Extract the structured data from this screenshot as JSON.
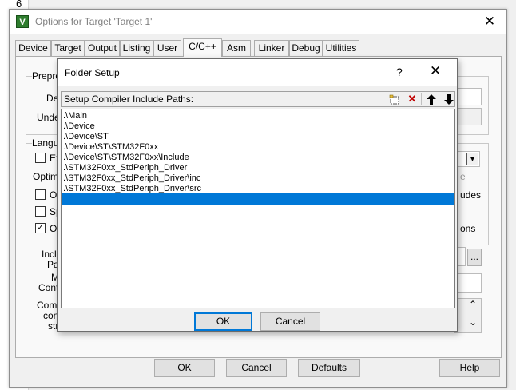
{
  "editor": {
    "line_number": "6"
  },
  "window": {
    "title": "Options for Target 'Target 1'",
    "close_glyph": "✕",
    "icon_letter": "V"
  },
  "tabs": [
    {
      "label": "Device"
    },
    {
      "label": "Target"
    },
    {
      "label": "Output"
    },
    {
      "label": "Listing"
    },
    {
      "label": "User"
    },
    {
      "label": "C/C++",
      "active": true
    },
    {
      "label": "Asm"
    },
    {
      "label": "Linker"
    },
    {
      "label": "Debug"
    },
    {
      "label": "Utilities"
    }
  ],
  "background_panel": {
    "preprocessor_label": "Prepro",
    "define_label": "De",
    "undefine_label": "Unde",
    "language_label": "Langu",
    "execute_only_label": "Ex",
    "optimization_label": "Optimiz",
    "option1_label": "Op",
    "option2_label": "Sp",
    "option3_label": "On",
    "option3_checked": "✓",
    "include_label": "Inclu",
    "paths_label": "Pat",
    "misc_label": "M",
    "controls_label": "Contr",
    "compiler_label": "Comp",
    "control_label": "cont",
    "string_label": "stri",
    "right_text_e": "e",
    "right_text_udes": "udes",
    "right_text_ons": "ons",
    "browse_button": "...",
    "dropdown_glyph": "▾",
    "scroll_up_glyph": "⌃",
    "scroll_down_glyph": "⌄"
  },
  "footer_buttons": {
    "ok": "OK",
    "cancel": "Cancel",
    "defaults": "Defaults",
    "help": "Help"
  },
  "folder_setup": {
    "title": "Folder Setup",
    "help_glyph": "?",
    "close_glyph": "✕",
    "list_header": "Setup Compiler Include Paths:",
    "toolbar": {
      "new_icon": "new-folder-icon",
      "delete_icon": "delete-icon",
      "up_icon": "move-up-icon",
      "down_icon": "move-down-icon",
      "delete_glyph": "✕",
      "up_glyph": "🡅",
      "down_glyph": "🡇",
      "delete_color": "#c00000"
    },
    "paths": [
      ".\\Main",
      ".\\Device",
      ".\\Device\\ST",
      ".\\Device\\ST\\STM32F0xx",
      ".\\Device\\ST\\STM32F0xx\\Include",
      ".\\STM32F0xx_StdPeriph_Driver",
      ".\\STM32F0xx_StdPeriph_Driver\\inc",
      ".\\STM32F0xx_StdPeriph_Driver\\src",
      ""
    ],
    "selected_index": 8,
    "selection_color": "#0078d7",
    "ok_button": "OK",
    "cancel_button": "Cancel"
  }
}
